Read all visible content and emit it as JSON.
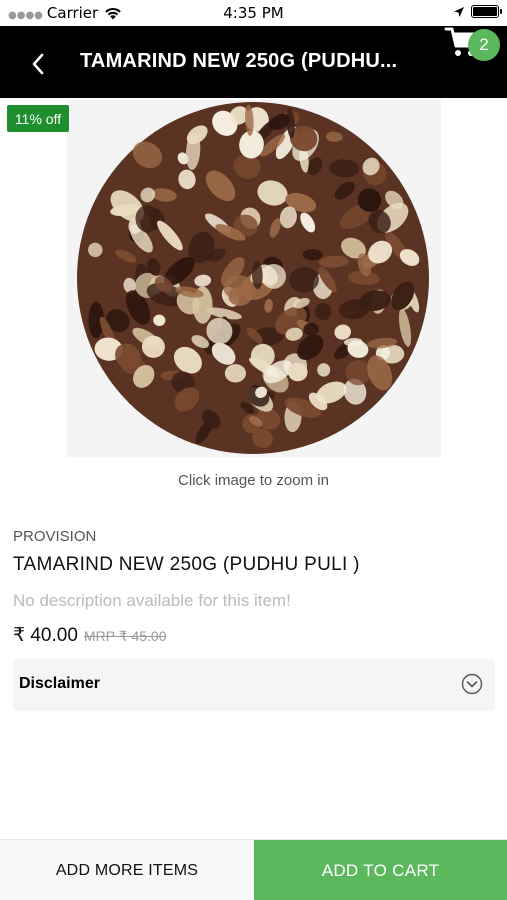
{
  "status_bar": {
    "carrier": "Carrier",
    "time": "4:35 PM"
  },
  "header": {
    "title": "TAMARIND NEW 250G (PUDHU...",
    "cart_count": "2",
    "back_icon": "chevron-left-icon",
    "cart_icon": "shopping-cart-icon"
  },
  "product": {
    "discount_label": "11% off",
    "zoom_hint": "Click image to zoom in",
    "category": "PROVISION",
    "name": "TAMARIND NEW 250G (PUDHU PULI )",
    "description": "No description available for this item!",
    "price": "₹ 40.00",
    "mrp": "MRP ₹ 45.00"
  },
  "disclaimer": {
    "label": "Disclaimer",
    "icon": "chevron-down-circle-icon"
  },
  "actions": {
    "add_more_label": "ADD MORE ITEMS",
    "add_to_cart_label": "ADD TO CART"
  },
  "colors": {
    "header_bg": "#000000",
    "accent_green": "#5cb85c",
    "discount_green": "#1e8f2e"
  }
}
